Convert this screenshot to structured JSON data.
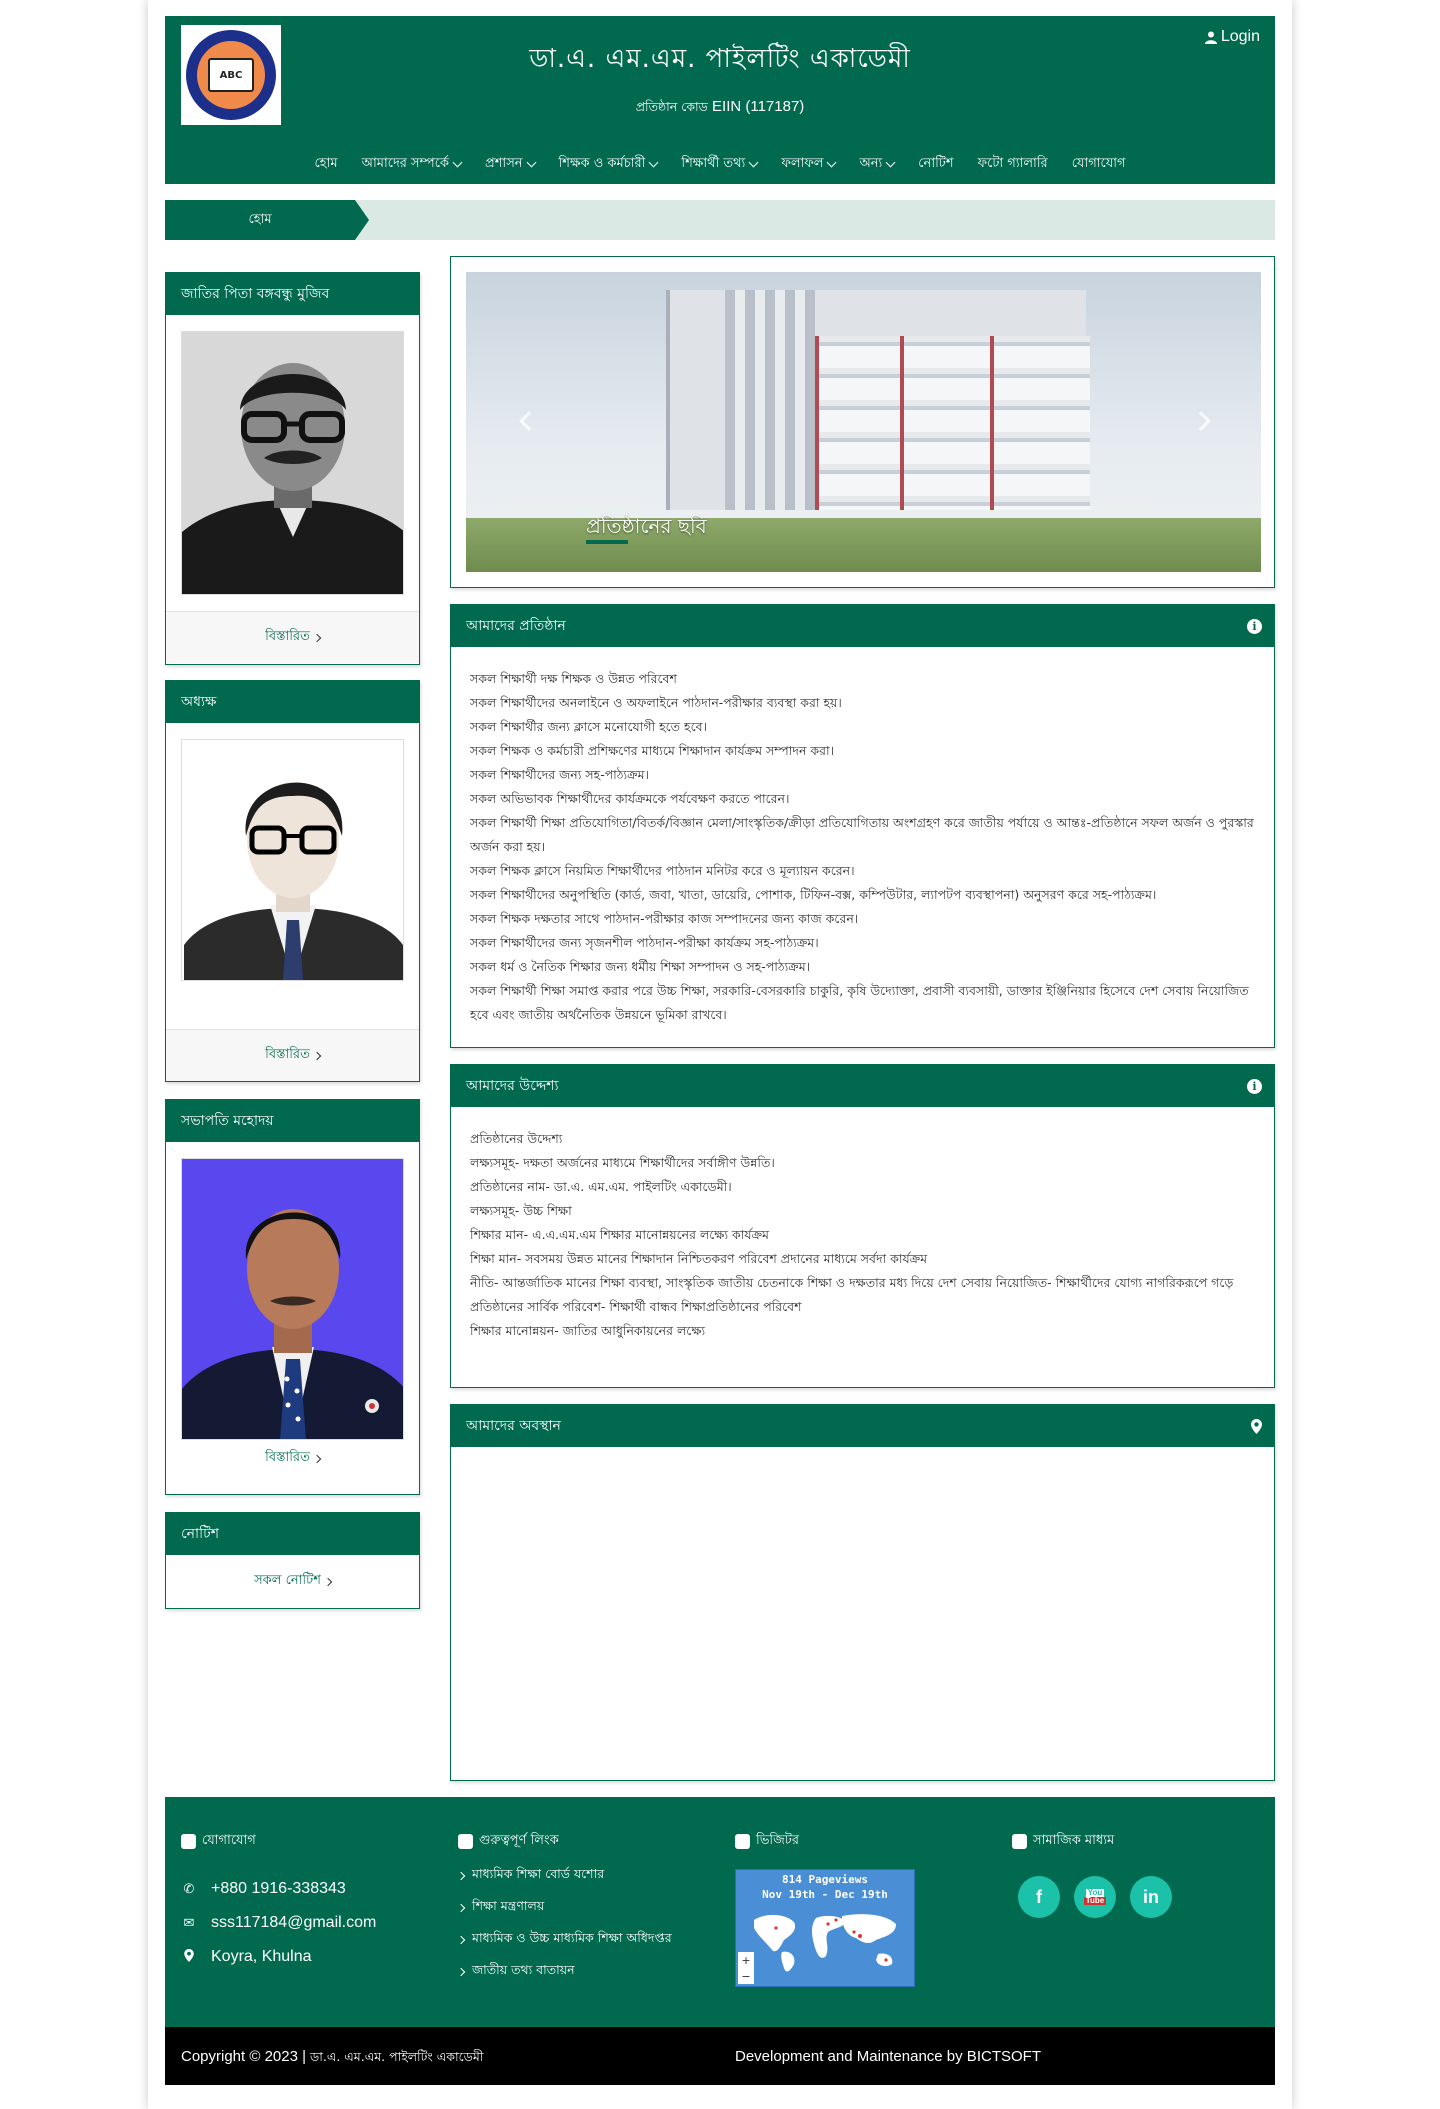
{
  "header": {
    "title": "ডা.এ. এম.এম. পাইলটিং একাডেমী",
    "subtitle_prefix": "প্রতিষ্ঠান কোড",
    "eiin": "EIIN (117187)",
    "login_label": "Login",
    "logo_text": "ABC"
  },
  "nav": [
    {
      "label": "হোম",
      "dropdown": false
    },
    {
      "label": "আমাদের সম্পর্কে",
      "dropdown": true
    },
    {
      "label": "প্রশাসন",
      "dropdown": true
    },
    {
      "label": "শিক্ষক ও কর্মচারী",
      "dropdown": true
    },
    {
      "label": "শিক্ষার্থী তথ্য",
      "dropdown": true
    },
    {
      "label": "ফলাফল",
      "dropdown": true
    },
    {
      "label": "অন্য",
      "dropdown": true
    },
    {
      "label": "নোটিশ",
      "dropdown": false
    },
    {
      "label": "ফটো গ্যালারি",
      "dropdown": false
    },
    {
      "label": "যোগাযোগ",
      "dropdown": false
    }
  ],
  "breadcrumb": {
    "home": "হোম"
  },
  "sidebar": {
    "father": {
      "title": "জাতির পিতা বঙ্গবন্ধু মুজিব",
      "more": "বিস্তারিত"
    },
    "principal": {
      "title": "অধ্যক্ষ",
      "more": "বিস্তারিত"
    },
    "president": {
      "title": "সভাপতি মহোদয়",
      "more": "বিস্তারিত"
    },
    "notice": {
      "title": "নোটিশ",
      "more": "সকল নোটিশ"
    }
  },
  "slider": {
    "caption": "প্রতিষ্ঠানের ছবি"
  },
  "section1": {
    "title": "আমাদের প্রতিষ্ঠান",
    "items": [
      "সকল শিক্ষার্থী দক্ষ শিক্ষক ও উন্নত পরিবেশ",
      "সকল শিক্ষার্থীদের অনলাইনে ও অফলাইনে পাঠদান-পরীক্ষার ব্যবস্থা করা হয়।",
      "সকল শিক্ষার্থীর জন্য ক্লাসে মনোযোগী হতে হবে।",
      "সকল শিক্ষক ও কর্মচারী প্রশিক্ষণের মাধ্যমে শিক্ষাদান কার্যক্রম সম্পাদন করা।",
      "সকল শিক্ষার্থীদের জন্য সহ-পাঠ্যক্রম।",
      "সকল অভিভাবক শিক্ষার্থীদের কার্যক্রমকে পর্যবেক্ষণ করতে পারেন।",
      "সকল শিক্ষার্থী শিক্ষা প্রতিযোগিতা/বিতর্ক/বিজ্ঞান মেলা/সাংস্কৃতিক/ক্রীড়া প্রতিযোগিতায় অংশগ্রহণ করে জাতীয় পর্যায়ে ও আন্তঃ-প্রতিষ্ঠানে সফল অর্জন ও পুরস্কার অর্জন করা হয়।",
      "সকল শিক্ষক ক্লাসে নিয়মিত শিক্ষার্থীদের পাঠদান মনিটর করে ও মূল্যায়ন করেন।",
      "সকল শিক্ষার্থীদের অনুপস্থিতি (কার্ড, জবা, খাতা, ডায়েরি, পোশাক, টিফিন-বক্স, কম্পিউটার, ল্যাপটপ ব্যবস্থাপনা) অনুসরণ করে সহ-পাঠ্যক্রম।",
      "সকল শিক্ষক দক্ষতার সাথে পাঠদান-পরীক্ষার কাজ সম্পাদনের জন্য কাজ করেন।",
      "সকল শিক্ষার্থীদের জন্য সৃজনশীল পাঠদান-পরীক্ষা কার্যক্রম সহ-পাঠ্যক্রম।",
      "সকল ধর্ম ও নৈতিক শিক্ষার জন্য ধর্মীয় শিক্ষা সম্পাদন ও সহ-পাঠ্যক্রম।",
      "সকল শিক্ষার্থী শিক্ষা সমাপ্ত করার পরে উচ্চ শিক্ষা, সরকারি-বেসরকারি চাকুরি, কৃষি উদ্যোক্তা, প্রবাসী ব্যবসায়ী, ডাক্তার ইঞ্জিনিয়ার হিসেবে দেশ সেবায় নিয়োজিত হবে এবং জাতীয় অর্থনৈতিক উন্নয়নে ভূমিকা রাখবে।"
    ]
  },
  "section2": {
    "title": "আমাদের উদ্দেশ্য",
    "items": [
      "প্রতিষ্ঠানের উদ্দেশ্য",
      "লক্ষ্যসমূহ- দক্ষতা অর্জনের মাধ্যমে শিক্ষার্থীদের সর্বাঙ্গীণ উন্নতি।",
      "প্রতিষ্ঠানের নাম- ডা.এ. এম.এম. পাইলটিং একাডেমী।",
      "লক্ষ্যসমূহ- উচ্চ শিক্ষা",
      "শিক্ষার মান- এ.এ.এম.এম শিক্ষার মানোন্নয়নের লক্ষ্যে কার্যক্রম",
      "শিক্ষা মান- সবসময় উন্নত মানের শিক্ষাদান নিশ্চিতকরণ পরিবেশ প্রদানের মাধ্যমে সর্বদা কার্যক্রম",
      "নীতি- আন্তর্জাতিক মানের শিক্ষা ব্যবস্থা, সাংস্কৃতিক জাতীয় চেতনাকে শিক্ষা ও দক্ষতার মধ্য দিয়ে দেশ সেবায় নিয়োজিত- শিক্ষার্থীদের যোগ্য নাগরিকরূপে গড়ে",
      "প্রতিষ্ঠানের সার্বিক পরিবেশ- শিক্ষার্থী বান্ধব শিক্ষাপ্রতিষ্ঠানের পরিবেশ",
      "শিক্ষার মানোন্নয়ন- জাতির আধুনিকায়নের লক্ষ্যে"
    ]
  },
  "section3": {
    "title": "আমাদের অবস্থান"
  },
  "footer": {
    "contact_title": "যোগাযোগ",
    "phone": "+880 1916-338343",
    "email": "sss117184@gmail.com",
    "address": "Koyra, Khulna",
    "links_title": "গুরুত্বপূর্ণ লিংক",
    "links": [
      "মাধ্যমিক শিক্ষা বোর্ড যশোর",
      "শিক্ষা মন্ত্রণালয়",
      "মাধ্যমিক ও উচ্চ মাধ্যমিক শিক্ষা অধিদপ্তর",
      "জাতীয় তথ্য বাতায়ন"
    ],
    "visitor_title": "ভিজিটর",
    "counter_line1": "814 Pageviews",
    "counter_line2": "Nov 19th - Dec 19th",
    "social_title": "সামাজিক মাধ্যম",
    "social": [
      "f",
      "You\nTube",
      "in"
    ],
    "copyright_prefix": "Copyright © 2023 |",
    "copyright_name": "ডা.এ. এম.এম. পাইলটিং একাডেমী",
    "developer": "Development and Maintenance by BICTSOFT"
  },
  "colors": {
    "brand": "#016a4e",
    "breadcrumb_bg": "#dae9e3",
    "social": "#1bc1a8"
  }
}
